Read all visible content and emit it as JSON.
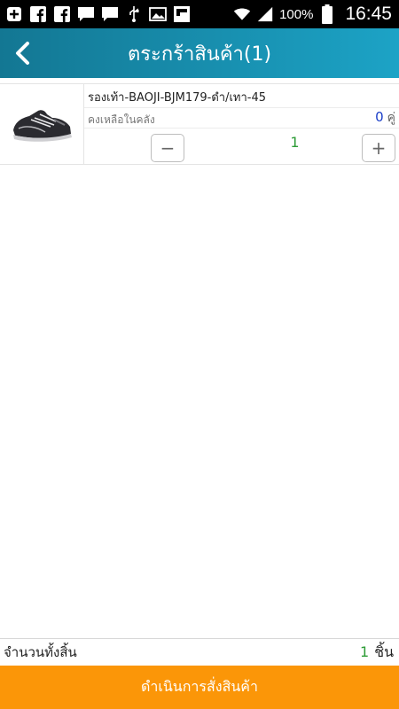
{
  "status_bar": {
    "battery_percent": "100%",
    "time": "16:45",
    "left_icons": [
      "plus-icon",
      "facebook-icon",
      "facebook-icon",
      "chat-icon",
      "chat-icon",
      "usb-icon",
      "image-icon",
      "flipboard-icon"
    ],
    "right_icons": [
      "wifi-icon",
      "signal-icon",
      "battery-icon"
    ]
  },
  "header": {
    "title": "ตระกร้าสินค้า(1)",
    "back_icon": "chevron-left-icon",
    "gradient_colors": [
      "#137793",
      "#1ca3c6"
    ]
  },
  "cart": {
    "items": [
      {
        "name": "รองเท้า-BAOJI-BJM179-ดำ/เทา-45",
        "stock_label": "คงเหลือในคลัง",
        "stock_count": "0",
        "stock_unit": "คู่",
        "quantity": "1",
        "minus_label": "−",
        "plus_label": "+",
        "image": "shoe-image"
      }
    ]
  },
  "footer": {
    "total_label": "จำนวนทั้งสิ้น",
    "total_count": "1",
    "total_unit": "ชิ้น",
    "checkout_label": "ดำเนินการสั่งสินค้า",
    "checkout_color": "#fb9608"
  }
}
